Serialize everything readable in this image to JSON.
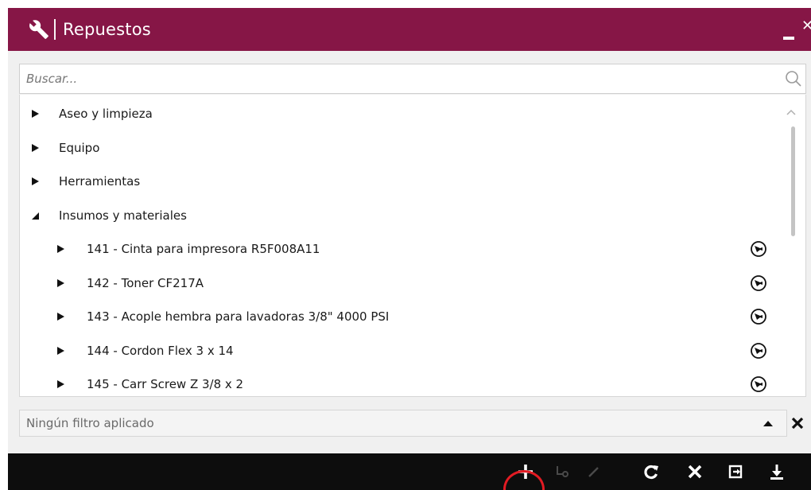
{
  "window": {
    "title": "Repuestos",
    "icon": "wrench-icon"
  },
  "search": {
    "placeholder": "Buscar..."
  },
  "categories": [
    {
      "label": "Aseo y limpieza",
      "expanded": false
    },
    {
      "label": "Equipo",
      "expanded": false
    },
    {
      "label": "Herramientas",
      "expanded": false
    },
    {
      "label": "Insumos y materiales",
      "expanded": true
    }
  ],
  "items": [
    {
      "label": "141 - Cinta para impresora R5F008A11"
    },
    {
      "label": "142 - Toner CF217A"
    },
    {
      "label": "143 - Acople hembra para lavadoras 3/8\" 4000 PSI"
    },
    {
      "label": "144 - Cordon Flex 3 x 14"
    },
    {
      "label": "145 - Carr Screw Z 3/8 x 2"
    }
  ],
  "filter": {
    "text": "Ningún filtro aplicado"
  },
  "toolbar": {
    "buttons": [
      "add",
      "link",
      "edit",
      "refresh",
      "delete",
      "export",
      "download"
    ],
    "highlighted": "add"
  },
  "colors": {
    "titlebar": "#861646",
    "toolbar": "#0d0d0d",
    "highlight": "#e21b23"
  }
}
